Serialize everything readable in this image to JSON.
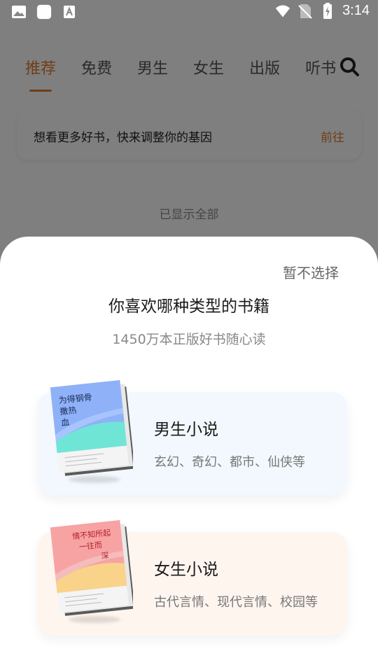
{
  "status_bar": {
    "time": "3:14"
  },
  "tabs": [
    {
      "label": "推荐"
    },
    {
      "label": "免费"
    },
    {
      "label": "男生"
    },
    {
      "label": "女生"
    },
    {
      "label": "出版"
    },
    {
      "label": "听书"
    }
  ],
  "gene_banner": {
    "text": "想看更多好书，快来调整你的基因",
    "action": "前往"
  },
  "list_footer": "已显示全部",
  "sheet": {
    "skip_label": "暂不选择",
    "title": "你喜欢哪种类型的书籍",
    "subtitle": "1450万本正版好书随心读",
    "options": [
      {
        "title": "男生小说",
        "desc": "玄幻、奇幻、都市、仙侠等",
        "book_title": [
          "为得钢骨",
          "撒热",
          "血"
        ]
      },
      {
        "title": "女生小说",
        "desc": "古代言情、现代言情、校园等",
        "book_title": [
          "情不知所起",
          "一往而",
          "深"
        ]
      }
    ]
  },
  "colors": {
    "accent": "#e27a2c",
    "male_bg": "#f2f8fd",
    "female_bg": "#fff5ef"
  }
}
